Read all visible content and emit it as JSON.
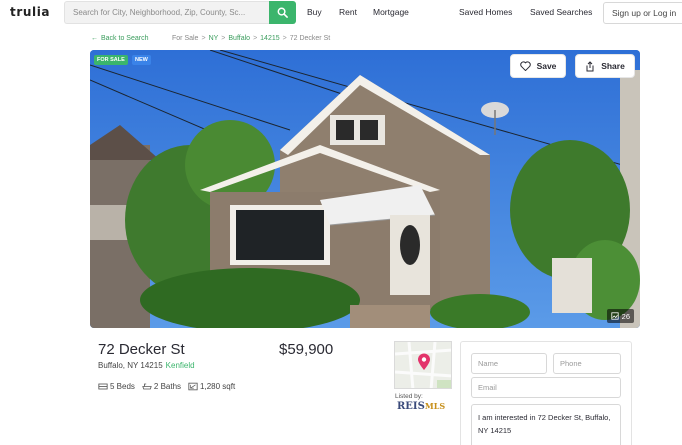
{
  "header": {
    "logo": "trulia",
    "search_placeholder": "Search for City, Neighborhood, Zip, County, Sc...",
    "nav": [
      "Buy",
      "Rent",
      "Mortgage"
    ],
    "saved_homes": "Saved Homes",
    "saved_searches": "Saved Searches",
    "login": "Sign up or Log in"
  },
  "breadcrumb": {
    "back": "Back to Search",
    "items": [
      "For Sale",
      "NY",
      "Buffalo",
      "14215",
      "72 Decker St"
    ],
    "separator": ">"
  },
  "photo": {
    "badge_sale": "FOR SALE",
    "badge_new": "NEW",
    "save_label": "Save",
    "share_label": "Share",
    "photo_count": "26"
  },
  "listing": {
    "address": "72 Decker St",
    "city_line": "Buffalo, NY 14215",
    "neighborhood": "Kenfield",
    "price": "$59,900",
    "beds": "5 Beds",
    "baths": "2 Baths",
    "sqft": "1,280 sqft"
  },
  "agent": {
    "listed_by": "Listed by:",
    "logo_text": "REIS",
    "logo_mls": "MLS"
  },
  "contact_form": {
    "name_placeholder": "Name",
    "phone_placeholder": "Phone",
    "email_placeholder": "Email",
    "message": "I am interested in 72 Decker St, Buffalo, NY 14215"
  },
  "colors": {
    "brand_green": "#3bb56c",
    "new_badge_blue": "#3a83e8",
    "link_green": "#3b9d5d"
  }
}
